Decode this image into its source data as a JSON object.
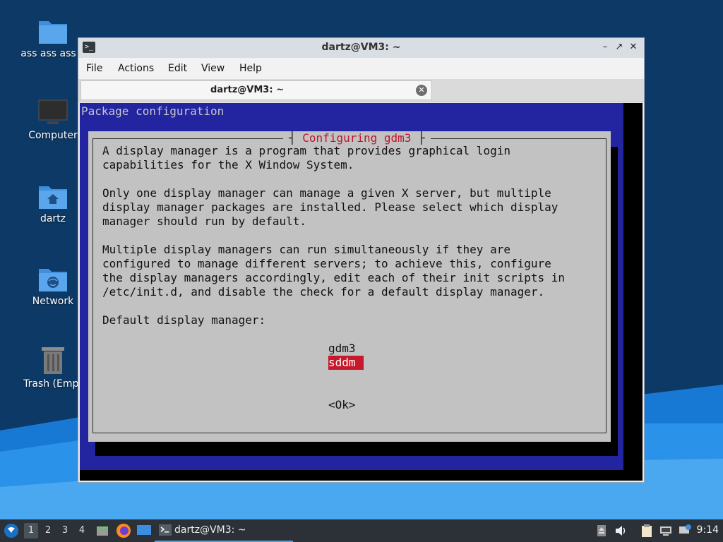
{
  "desktop": {
    "icons": [
      {
        "label": "ass ass ass a",
        "icon": "folder-icon"
      },
      {
        "label": "Computer",
        "icon": "computer-icon"
      },
      {
        "label": "dartz",
        "icon": "home-folder-icon"
      },
      {
        "label": "Network",
        "icon": "network-folder-icon"
      },
      {
        "label": "Trash (Empt",
        "icon": "trash-icon"
      }
    ]
  },
  "window": {
    "title": "dartz@VM3: ~",
    "menu": [
      "File",
      "Actions",
      "Edit",
      "View",
      "Help"
    ],
    "tab_label": "dartz@VM3: ~"
  },
  "terminal": {
    "header": "Package configuration",
    "dialog_title": "Configuring gdm3",
    "paragraphs": [
      "A display manager is a program that provides graphical login",
      "capabilities for the X Window System.",
      "",
      "Only one display manager can manage a given X server, but multiple",
      "display manager packages are installed. Please select which display",
      "manager should run by default.",
      "",
      "Multiple display managers can run simultaneously if they are",
      "configured to manage different servers; to achieve this, configure",
      "the display managers accordingly, edit each of their init scripts in",
      "/etc/init.d, and disable the check for a default display manager.",
      "",
      "Default display manager:"
    ],
    "options": [
      "gdm3",
      "sddm"
    ],
    "selected_option": "sddm",
    "ok_label": "<Ok>"
  },
  "taskbar": {
    "workspaces": [
      "1",
      "2",
      "3",
      "4"
    ],
    "active_workspace": "1",
    "task_label": "dartz@VM3: ~",
    "clock": "9:14"
  },
  "colors": {
    "desktop": "#0e3a66",
    "dialog_bg": "#2324a0",
    "selection": "#c7192b",
    "title_red": "#c0162a"
  }
}
